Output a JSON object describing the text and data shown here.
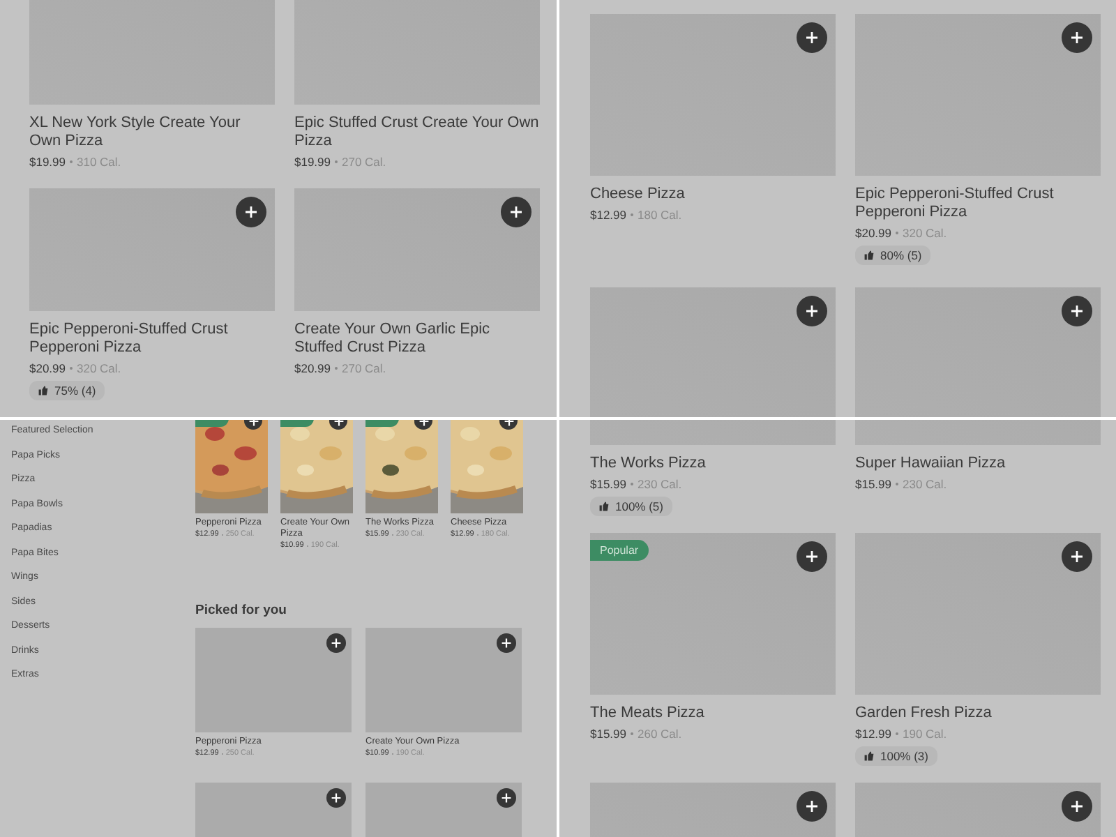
{
  "panels": [
    {
      "kind": "grid",
      "items": [
        {
          "title": "XL New York Style Create Your Own Pizza",
          "price": "$19.99",
          "calories": "310 Cal.",
          "add_button": false
        },
        {
          "title": "Epic Stuffed Crust Create Your Own Pizza",
          "price": "$19.99",
          "calories": "270 Cal.",
          "add_button": false
        },
        {
          "title": "Epic Pepperoni-Stuffed Crust Pepperoni Pizza",
          "price": "$20.99",
          "calories": "320 Cal.",
          "rating": "75% (4)",
          "add_button": true
        },
        {
          "title": "Create Your Own Garlic Epic Stuffed Crust Pizza",
          "price": "$20.99",
          "calories": "270 Cal.",
          "add_button": true
        }
      ]
    },
    {
      "kind": "grid",
      "items": [
        {
          "title": "Cheese Pizza",
          "price": "$12.99",
          "calories": "180 Cal.",
          "add_button": true
        },
        {
          "title": "Epic Pepperoni-Stuffed Crust Pepperoni Pizza",
          "price": "$20.99",
          "calories": "320 Cal.",
          "rating": "80% (5)",
          "add_button": true
        },
        {
          "add_button": true
        },
        {
          "add_button": true
        }
      ]
    },
    {
      "kind": "menu",
      "categories": [
        "Featured Selection",
        "Papa Picks",
        "Pizza",
        "Papa Bowls",
        "Papadias",
        "Papa Bites",
        "Wings",
        "Sides",
        "Desserts",
        "Drinks",
        "Extras"
      ],
      "featured": [
        {
          "title": "Pepperoni Pizza",
          "price": "$12.99",
          "calories": "250 Cal.",
          "highlight": true
        },
        {
          "title": "Create Your Own Pizza",
          "price": "$10.99",
          "calories": "190 Cal.",
          "highlight": true
        },
        {
          "title": "The Works Pizza",
          "price": "$15.99",
          "calories": "230 Cal.",
          "highlight": true
        },
        {
          "title": "Cheese Pizza",
          "price": "$12.99",
          "calories": "180 Cal.",
          "highlight": false
        }
      ],
      "section_title": "Picked for you",
      "picked": [
        {
          "title": "Pepperoni Pizza",
          "price": "$12.99",
          "calories": "250 Cal.",
          "add_button": true
        },
        {
          "title": "Create Your Own Pizza",
          "price": "$10.99",
          "calories": "190 Cal.",
          "add_button": true
        },
        {
          "add_button": true
        },
        {
          "add_button": true
        }
      ]
    },
    {
      "kind": "grid",
      "items": [
        {
          "title": "The Works Pizza",
          "price": "$15.99",
          "calories": "230 Cal.",
          "rating": "100% (5)",
          "add_button": false
        },
        {
          "title": "Super Hawaiian Pizza",
          "price": "$15.99",
          "calories": "230 Cal.",
          "add_button": false
        },
        {
          "title": "The Meats Pizza",
          "price": "$15.99",
          "calories": "260 Cal.",
          "badge": "Popular",
          "add_button": true
        },
        {
          "title": "Garden Fresh Pizza",
          "price": "$12.99",
          "calories": "190 Cal.",
          "rating": "100% (3)",
          "add_button": true
        },
        {
          "add_button": true
        },
        {
          "add_button": true
        }
      ]
    }
  ]
}
